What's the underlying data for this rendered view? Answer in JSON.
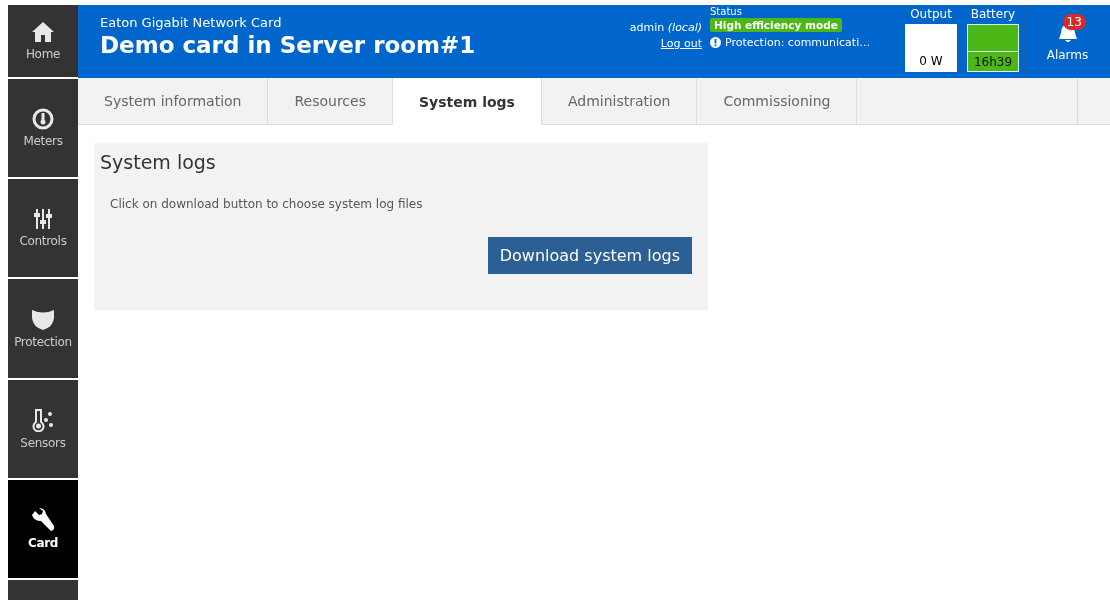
{
  "sidebar": {
    "items": [
      {
        "kind": "home",
        "label": "Home",
        "selected": false
      },
      {
        "kind": "meters",
        "label": "Meters",
        "selected": false
      },
      {
        "kind": "controls",
        "label": "Controls",
        "selected": false
      },
      {
        "kind": "protection",
        "label": "Protection",
        "selected": false
      },
      {
        "kind": "sensors",
        "label": "Sensors",
        "selected": false
      },
      {
        "kind": "card",
        "label": "Card",
        "selected": true
      }
    ]
  },
  "header": {
    "product": "Eaton Gigabit Network Card",
    "title": "Demo card in Server room#1",
    "user": "admin *(local)*",
    "logout": "Log out",
    "status": {
      "label": "Status",
      "mode": "High efficiency mode",
      "message": "Protection: communicati…"
    },
    "output": {
      "label": "Output",
      "value": "0 W"
    },
    "battery": {
      "label": "Battery",
      "value": "16h39"
    },
    "alarms": {
      "label": "Alarms",
      "count": "13"
    }
  },
  "tabs": [
    {
      "label": "System information",
      "selected": false
    },
    {
      "label": "Resources",
      "selected": false
    },
    {
      "label": "System logs",
      "selected": true
    },
    {
      "label": "Administration",
      "selected": false
    },
    {
      "label": "Commissioning",
      "selected": false
    }
  ],
  "panel": {
    "title": "System logs",
    "text": "Click on download button to choose system log files",
    "button": "Download system logs"
  }
}
